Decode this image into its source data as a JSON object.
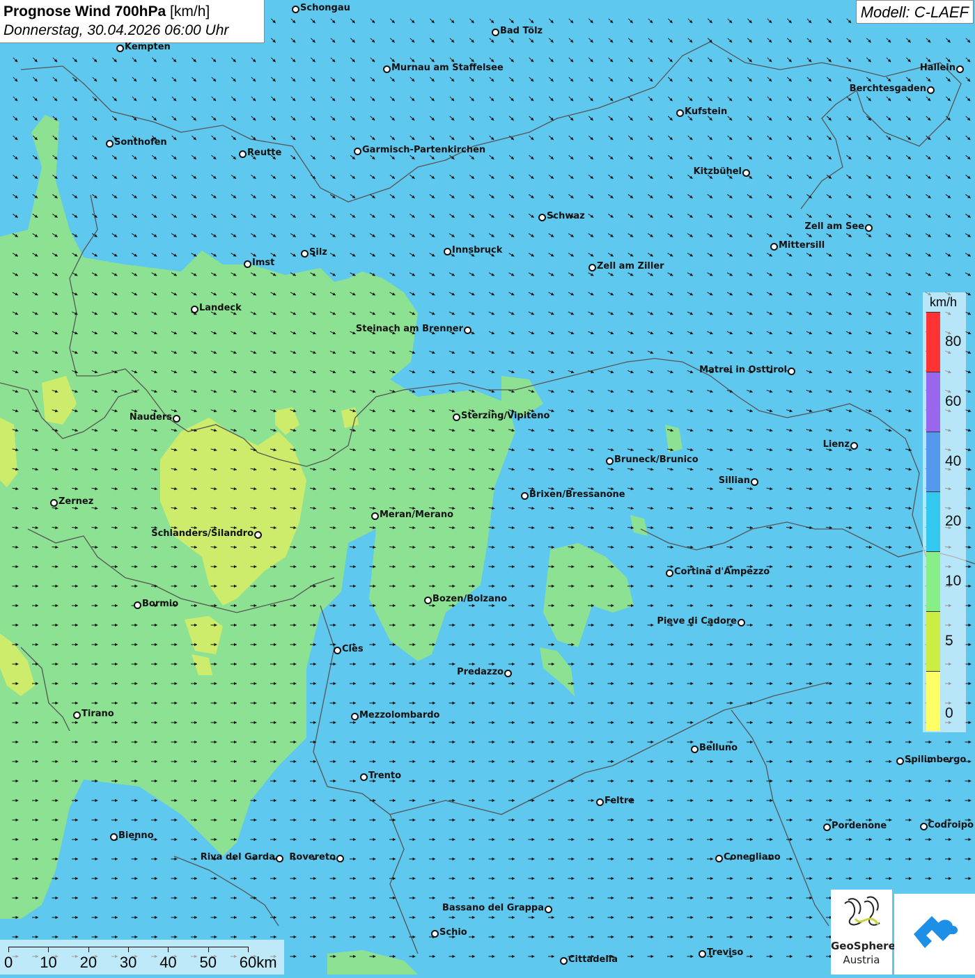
{
  "header": {
    "title_bold": "Prognose Wind 700hPa",
    "title_unit": "[km/h]",
    "subtitle": "Donnerstag, 30.04.2026 06:00 Uhr",
    "model": "Modell: C-LAEF"
  },
  "legend": {
    "unit": "km/h",
    "ticks": [
      "0",
      "5",
      "10",
      "20",
      "40",
      "60",
      "80"
    ],
    "colors": [
      "#ffff66",
      "#ccee44",
      "#88ee88",
      "#33c8f0",
      "#5599ee",
      "#9966ee",
      "#ff3333"
    ]
  },
  "colors": {
    "ocean_blue": "#5ec8ee",
    "green_zone": "#8ee48c",
    "yellow_zone": "#d2ec6a",
    "border": "#555555",
    "arrow": "#111111"
  },
  "cities": [
    {
      "name": "Schongau",
      "dot": [
        424,
        13
      ],
      "label_side": "right"
    },
    {
      "name": "Bad Tölz",
      "dot": [
        711,
        46
      ],
      "label_side": "right"
    },
    {
      "name": "Kempten",
      "dot": [
        172,
        69
      ],
      "label_side": "right"
    },
    {
      "name": "Murnau am Staffelsee",
      "dot": [
        555,
        99
      ],
      "label_side": "right"
    },
    {
      "name": "Hallein",
      "dot": [
        1378,
        99
      ],
      "label_side": "left"
    },
    {
      "name": "Berchtesgaden",
      "dot": [
        1336,
        129
      ],
      "label_side": "left"
    },
    {
      "name": "Kufstein",
      "dot": [
        976,
        162
      ],
      "label_side": "right"
    },
    {
      "name": "Sonthofen",
      "dot": [
        157,
        206
      ],
      "label_side": "right"
    },
    {
      "name": "Reutte",
      "dot": [
        348,
        221
      ],
      "label_side": "right"
    },
    {
      "name": "Garmisch-Partenkirchen",
      "dot": [
        513,
        217
      ],
      "label_side": "right"
    },
    {
      "name": "Kitzbühel",
      "dot": [
        1071,
        248
      ],
      "label_side": "left"
    },
    {
      "name": "Schwaz",
      "dot": [
        778,
        312
      ],
      "label_side": "right"
    },
    {
      "name": "Zell am See",
      "dot": [
        1247,
        327
      ],
      "label_side": "left"
    },
    {
      "name": "Mittersill",
      "dot": [
        1111,
        354
      ],
      "label_side": "right"
    },
    {
      "name": "Innsbruck",
      "dot": [
        642,
        361
      ],
      "label_side": "right"
    },
    {
      "name": "Imst",
      "dot": [
        355,
        379
      ],
      "label_side": "right"
    },
    {
      "name": "Silz",
      "dot": [
        437,
        364
      ],
      "label_side": "right"
    },
    {
      "name": "Zell am Ziller",
      "dot": [
        850,
        384
      ],
      "label_side": "right"
    },
    {
      "name": "Landeck",
      "dot": [
        279,
        444
      ],
      "label_side": "right"
    },
    {
      "name": "Steinach am Brenner",
      "dot": [
        671,
        474
      ],
      "label_side": "left"
    },
    {
      "name": "Matrei in Osttirol",
      "dot": [
        1136,
        533
      ],
      "label_side": "left"
    },
    {
      "name": "Nauders",
      "dot": [
        253,
        601
      ],
      "label_side": "left"
    },
    {
      "name": "Sterzing/Vipiteno",
      "dot": [
        655,
        599
      ],
      "label_side": "right"
    },
    {
      "name": "Lienz",
      "dot": [
        1226,
        640
      ],
      "label_side": "left"
    },
    {
      "name": "Bruneck/Brunico",
      "dot": [
        875,
        662
      ],
      "label_side": "right"
    },
    {
      "name": "Sillian",
      "dot": [
        1083,
        692
      ],
      "label_side": "left"
    },
    {
      "name": "Brixen/Bressanone",
      "dot": [
        753,
        712
      ],
      "label_side": "right"
    },
    {
      "name": "Zernez",
      "dot": [
        77,
        722
      ],
      "label_side": "right"
    },
    {
      "name": "Meran/Merano",
      "dot": [
        538,
        741
      ],
      "label_side": "right"
    },
    {
      "name": "Schlanders/Silandro",
      "dot": [
        370,
        768
      ],
      "label_side": "left"
    },
    {
      "name": "Cortina d'Ampezzo",
      "dot": [
        961,
        823
      ],
      "label_side": "right"
    },
    {
      "name": "Bozen/Bolzano",
      "dot": [
        614,
        862
      ],
      "label_side": "right"
    },
    {
      "name": "Bormio",
      "dot": [
        197,
        869
      ],
      "label_side": "right"
    },
    {
      "name": "Pieve di Cadore",
      "dot": [
        1064,
        894
      ],
      "label_side": "left"
    },
    {
      "name": "Cles",
      "dot": [
        484,
        934
      ],
      "label_side": "right"
    },
    {
      "name": "Predazzo",
      "dot": [
        729,
        967
      ],
      "label_side": "left"
    },
    {
      "name": "Tirano",
      "dot": [
        110,
        1027
      ],
      "label_side": "right"
    },
    {
      "name": "Mezzolombardo",
      "dot": [
        509,
        1029
      ],
      "label_side": "right"
    },
    {
      "name": "Belluno",
      "dot": [
        997,
        1076
      ],
      "label_side": "right"
    },
    {
      "name": "Spilimbergo",
      "dot": [
        1292,
        1093
      ],
      "label_side": "right"
    },
    {
      "name": "Trento",
      "dot": [
        522,
        1116
      ],
      "label_side": "right"
    },
    {
      "name": "Feltre",
      "dot": [
        861,
        1152
      ],
      "label_side": "right"
    },
    {
      "name": "Pordenone",
      "dot": [
        1187,
        1188
      ],
      "label_side": "right"
    },
    {
      "name": "Codroipo",
      "dot": [
        1326,
        1187
      ],
      "label_side": "right"
    },
    {
      "name": "Bienno",
      "dot": [
        163,
        1202
      ],
      "label_side": "right"
    },
    {
      "name": "Riva del Garda",
      "dot": [
        401,
        1233
      ],
      "label_side": "left"
    },
    {
      "name": "Rovereto",
      "dot": [
        488,
        1233
      ],
      "label_side": "left"
    },
    {
      "name": "Conegliano",
      "dot": [
        1032,
        1233
      ],
      "label_side": "right"
    },
    {
      "name": "Bassano del Grappa",
      "dot": [
        787,
        1306
      ],
      "label_side": "left"
    },
    {
      "name": "Schio",
      "dot": [
        624,
        1341
      ],
      "label_side": "right"
    },
    {
      "name": "Treviso",
      "dot": [
        1008,
        1370
      ],
      "label_side": "right"
    },
    {
      "name": "Cittadella",
      "dot": [
        809,
        1380
      ],
      "label_side": "right"
    }
  ],
  "scalebar": {
    "labels": [
      "0",
      "10",
      "20",
      "30",
      "40",
      "50",
      "60km"
    ]
  },
  "logos": {
    "geosphere_line1": "GeoSphere",
    "geosphere_line2": "Austria"
  }
}
